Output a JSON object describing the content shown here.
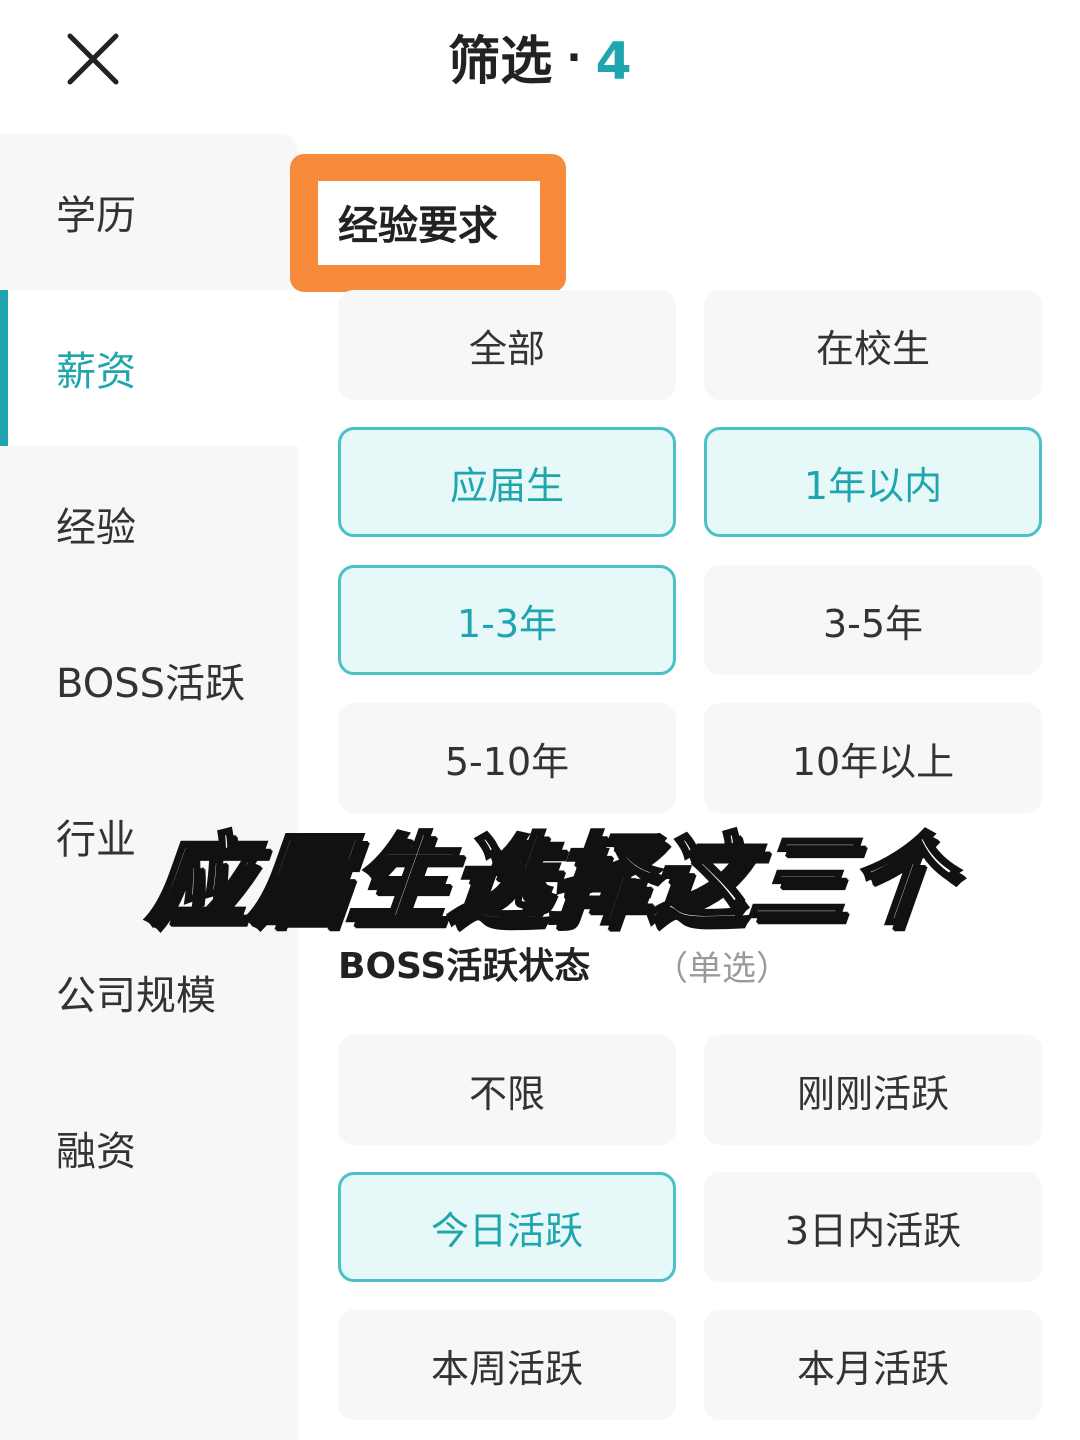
{
  "header": {
    "title": "筛选",
    "separator": "·",
    "count": "4"
  },
  "sidebar": {
    "items": [
      {
        "label": "学历"
      },
      {
        "label": "薪资"
      },
      {
        "label": "经验"
      },
      {
        "label": "BOSS活跃"
      },
      {
        "label": "行业"
      },
      {
        "label": "公司规模"
      },
      {
        "label": "融资"
      }
    ],
    "active": "薪资"
  },
  "experience": {
    "title": "经验要求",
    "options": [
      {
        "label": "全部",
        "selected": false
      },
      {
        "label": "在校生",
        "selected": false
      },
      {
        "label": "应届生",
        "selected": true
      },
      {
        "label": "1年以内",
        "selected": true
      },
      {
        "label": "1-3年",
        "selected": true
      },
      {
        "label": "3-5年",
        "selected": false
      },
      {
        "label": "5-10年",
        "selected": false
      },
      {
        "label": "10年以上",
        "selected": false
      }
    ]
  },
  "boss_activity": {
    "title": "BOSS活跃状态",
    "hint": "（单选）",
    "options": [
      {
        "label": "不限",
        "selected": false
      },
      {
        "label": "刚刚活跃",
        "selected": false
      },
      {
        "label": "今日活跃",
        "selected": true
      },
      {
        "label": "3日内活跃",
        "selected": false
      },
      {
        "label": "本周活跃",
        "selected": false
      },
      {
        "label": "本月活跃",
        "selected": false
      }
    ]
  },
  "overlay_caption": "应届生选择这三个",
  "colors": {
    "accent": "#1fa5ad",
    "selected_border": "#49c1c6",
    "selected_bg": "#e6f8f8",
    "highlight": "#f78b3b"
  }
}
